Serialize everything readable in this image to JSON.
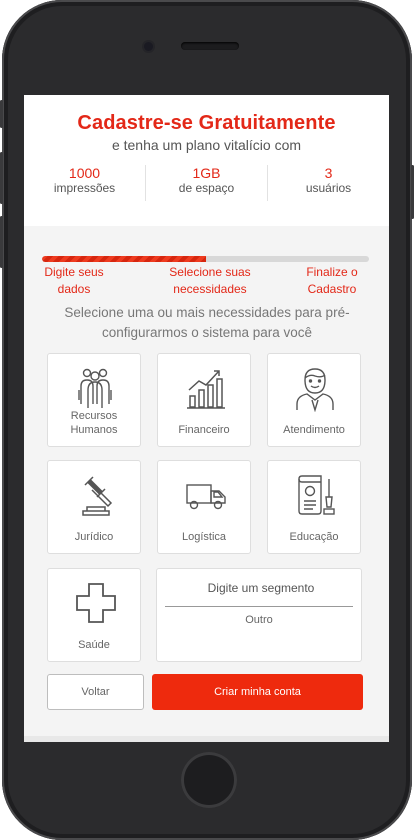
{
  "header": {
    "title": "Cadastre-se Gratuitamente",
    "subtitle": "e tenha um plano vitalício com"
  },
  "stats": [
    {
      "value": "1000",
      "label": "impressões"
    },
    {
      "value": "1GB",
      "label": "de espaço"
    },
    {
      "value": "3",
      "label": "usuários"
    }
  ],
  "progress": {
    "fraction": 0.5
  },
  "steps": [
    {
      "line1": "Digite seus",
      "line2": "dados"
    },
    {
      "line1": "Selecione suas",
      "line2": "necessidades"
    },
    {
      "line1": "Finalize o",
      "line2": "Cadastro"
    }
  ],
  "hint": {
    "line1": "Selecione uma ou mais necessidades para pré-",
    "line2": "configurarmos o sistema para você"
  },
  "needs": [
    {
      "line1": "Recursos",
      "line2": "Humanos",
      "icon": "people-group-icon"
    },
    {
      "line1": "Financeiro",
      "line2": "",
      "icon": "bar-chart-icon"
    },
    {
      "line1": "Atendimento",
      "line2": "",
      "icon": "attendant-icon"
    },
    {
      "line1": "Jurídico",
      "line2": "",
      "icon": "gavel-icon"
    },
    {
      "line1": "Logística",
      "line2": "",
      "icon": "truck-icon"
    },
    {
      "line1": "Educação",
      "line2": "",
      "icon": "certificate-icon"
    },
    {
      "line1": "Saúde",
      "line2": "",
      "icon": "health-cross-icon"
    }
  ],
  "segment": {
    "placeholder": "Digite um segmento",
    "label": "Outro"
  },
  "buttons": {
    "back": "Voltar",
    "create": "Criar minha conta"
  },
  "colors": {
    "accent": "#e32818",
    "button": "#ee2a0d"
  }
}
